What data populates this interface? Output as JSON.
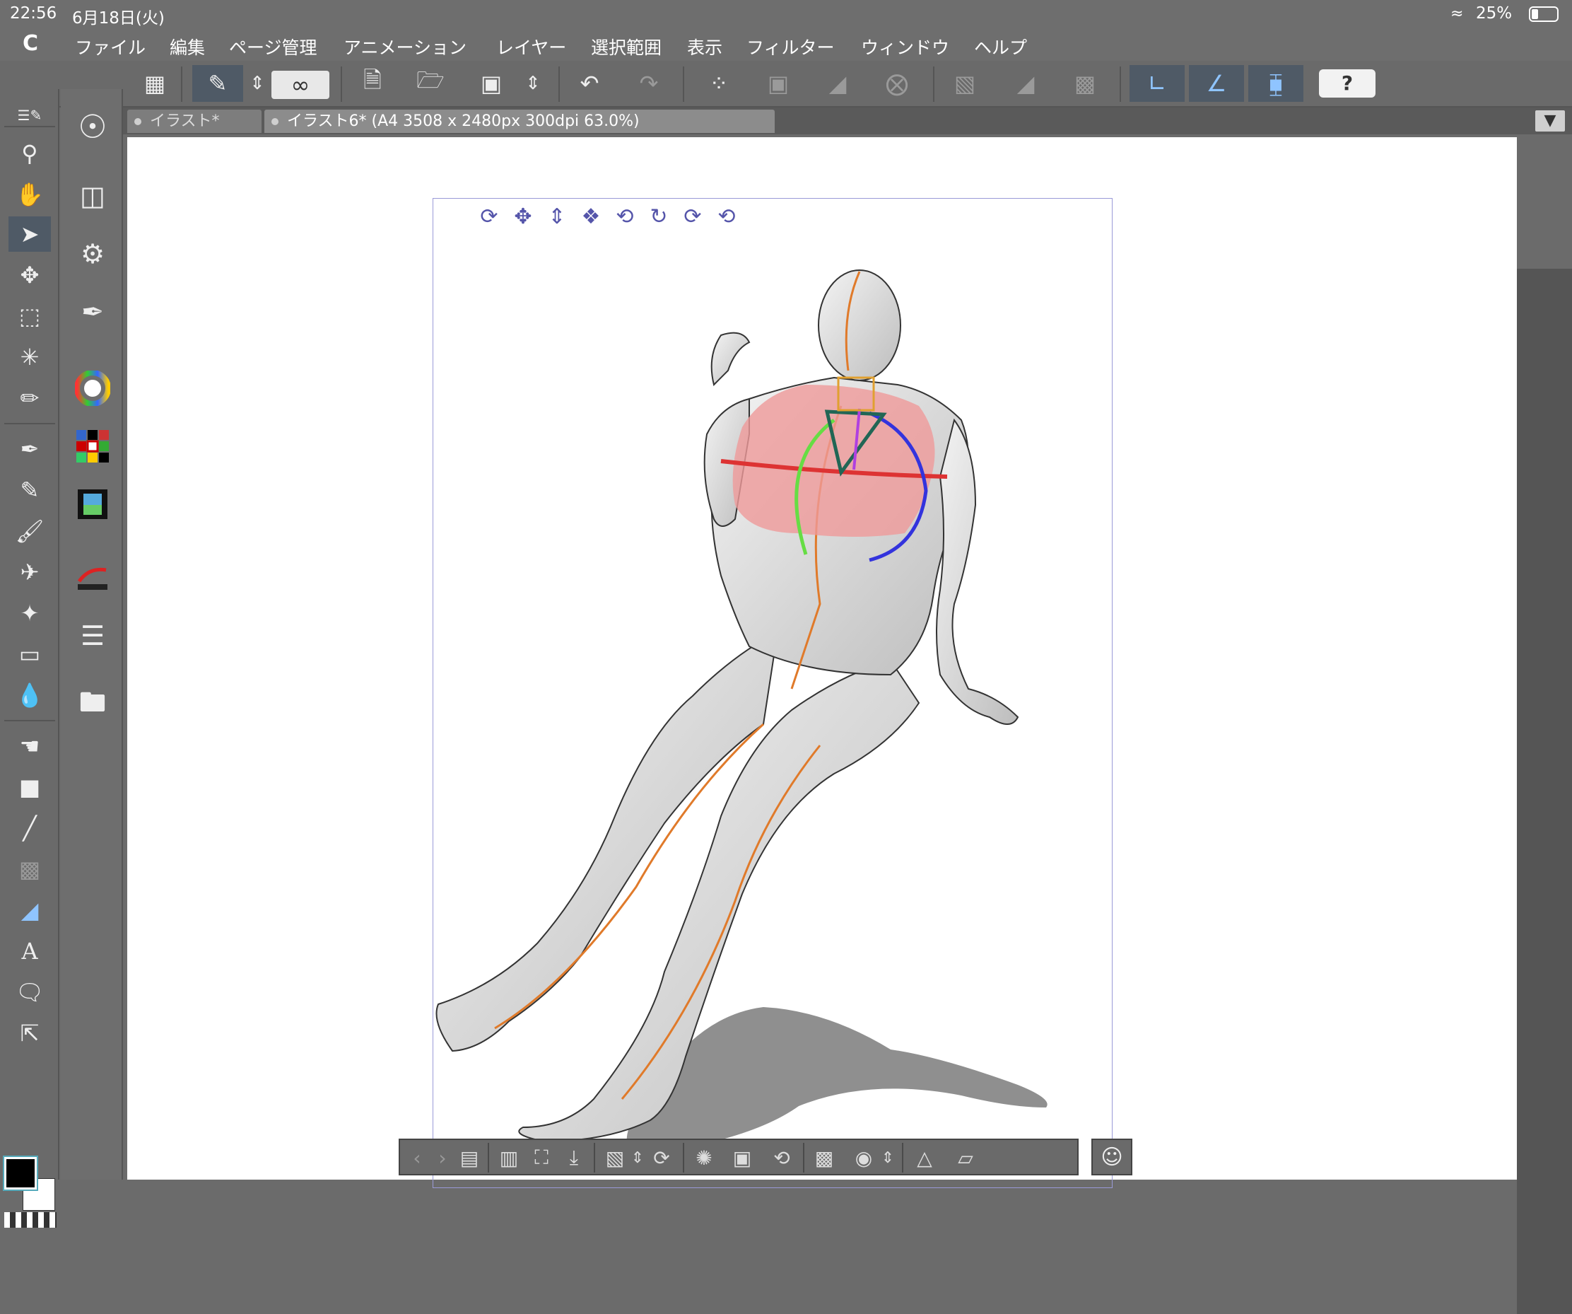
{
  "status": {
    "time": "22:56",
    "date": "6月18日(火)",
    "wifi_icon": "wifi-icon",
    "battery": "25%"
  },
  "menu": {
    "logo": "C",
    "items": [
      "ファイル",
      "編集",
      "ページ管理",
      "アニメーション",
      "レイヤー",
      "選択範囲",
      "表示",
      "フィルター",
      "ウィンドウ",
      "ヘルプ"
    ]
  },
  "toolbar": {
    "help_label": "?",
    "icons": [
      "grid-icon",
      "canvas-transform-icon",
      "up-down-arrows-icon",
      "logo-swirl-icon",
      "new-document-icon",
      "open-folder-icon",
      "save-icon",
      "up-down-arrows-icon",
      "undo-icon",
      "redo-icon",
      "dots-icon",
      "cube-icon",
      "fill-icon",
      "transform-icon",
      "snap-icon",
      "gradient-icon",
      "ruler-frame-icon",
      "snap-ruler-icon",
      "snap-special-ruler-icon",
      "snap-grid-icon"
    ]
  },
  "tabs": [
    {
      "label": "イラスト*"
    },
    {
      "label": "イラスト6* (A4 3508 x 2480px 300dpi 63.0%)"
    }
  ],
  "tools_left": [
    "zoom-icon",
    "hand-icon",
    "object-icon",
    "move-icon",
    "selection-icon",
    "magic-wand-icon",
    "eyedropper-icon",
    "pen-icon",
    "pencil-icon",
    "brush-icon",
    "airbrush-icon",
    "decoration-icon",
    "eraser-icon",
    "blend-icon",
    "fill-icon",
    "gradient-icon",
    "figure-icon",
    "frame-icon",
    "ruler-icon",
    "text-icon",
    "balloon-icon",
    "correct-line-icon"
  ],
  "palettes_left": [
    "quick-access-icon",
    "sub-tool-icon",
    "tool-property-icon",
    "brush-size-icon",
    "color-wheel-icon",
    "color-set-icon",
    "animation-icon",
    "navigator-icon",
    "layer-icon",
    "material-icon"
  ],
  "colors": {
    "main": "#000000",
    "sub": "#ffffff",
    "accent_selected": "#4f5a66"
  },
  "bottom_bar": {
    "icons": [
      "prev-icon",
      "next-icon",
      "list-icon",
      "load-pose-icon",
      "focus-icon",
      "place-ground-icon",
      "save-pose-icon",
      "up-down-icon",
      "rotate-pose-icon",
      "pose-lock-icon",
      "cube-settings-icon",
      "reset-icon",
      "save-icon",
      "camera-icon",
      "up-down-icon",
      "share-pose-icon",
      "flip-icon"
    ]
  },
  "bottom_right_icon": "user-icon",
  "model_manipulator_icons": [
    "camera-rotate-icon",
    "camera-pan-icon",
    "camera-dolly-icon",
    "move-plane-icon",
    "rotate-view-icon",
    "rotate-z-icon",
    "rotate-y-icon",
    "rotate-x-icon"
  ]
}
